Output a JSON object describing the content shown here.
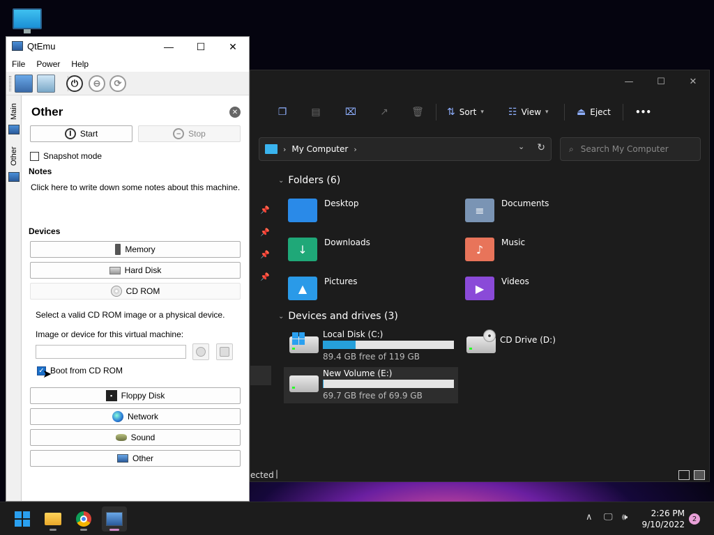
{
  "explorer": {
    "command_bar": {
      "sort": "Sort",
      "view": "View",
      "eject": "Eject",
      "more": "•••"
    },
    "address": {
      "location": "My Computer"
    },
    "search": {
      "placeholder": "Search My Computer"
    },
    "sections": {
      "folders": "Folders (6)",
      "devices": "Devices and drives (3)"
    },
    "folders": [
      {
        "name": "Desktop",
        "color": "#2a8ae8",
        "glyph": ""
      },
      {
        "name": "Documents",
        "color": "#7a94b4",
        "glyph": "≡"
      },
      {
        "name": "Downloads",
        "color": "#1fa878",
        "glyph": "↓"
      },
      {
        "name": "Music",
        "color": "#e8745a",
        "glyph": "♪"
      },
      {
        "name": "Pictures",
        "color": "#2a9ae8",
        "glyph": "▲"
      },
      {
        "name": "Videos",
        "color": "#8a4ad8",
        "glyph": "▶"
      }
    ],
    "drives": [
      {
        "name": "Local Disk (C:)",
        "free": "89.4 GB free of 119 GB",
        "used_fraction": 0.25
      },
      {
        "name": "CD Drive (D:)"
      },
      {
        "name": "New Volume (E:)",
        "free": "69.7 GB free of 69.9 GB",
        "used_fraction": 0.003
      }
    ],
    "status_text": "ected"
  },
  "qtemu": {
    "title": "QtEmu",
    "menu": [
      "File",
      "Power",
      "Help"
    ],
    "side_tabs": {
      "main": "Main",
      "other": "Other"
    },
    "panel": {
      "title": "Other",
      "start": "Start",
      "stop": "Stop",
      "snapshot": "Snapshot mode",
      "notes_header": "Notes",
      "notes_text": "Click here to write down some notes about this machine.",
      "devices_header": "Devices",
      "memory": "Memory",
      "hard_disk": "Hard Disk",
      "cd_rom": "CD ROM",
      "cd_hint": "Select a valid CD ROM image or a physical device.",
      "cd_image_label": "Image or device for this virtual machine:",
      "cd_image_value": "",
      "boot_from_cd": "Boot from CD ROM",
      "floppy": "Floppy Disk",
      "network": "Network",
      "sound": "Sound",
      "other": "Other"
    }
  },
  "taskbar": {
    "time": "2:26 PM",
    "date": "9/10/2022",
    "notifications": "2"
  }
}
